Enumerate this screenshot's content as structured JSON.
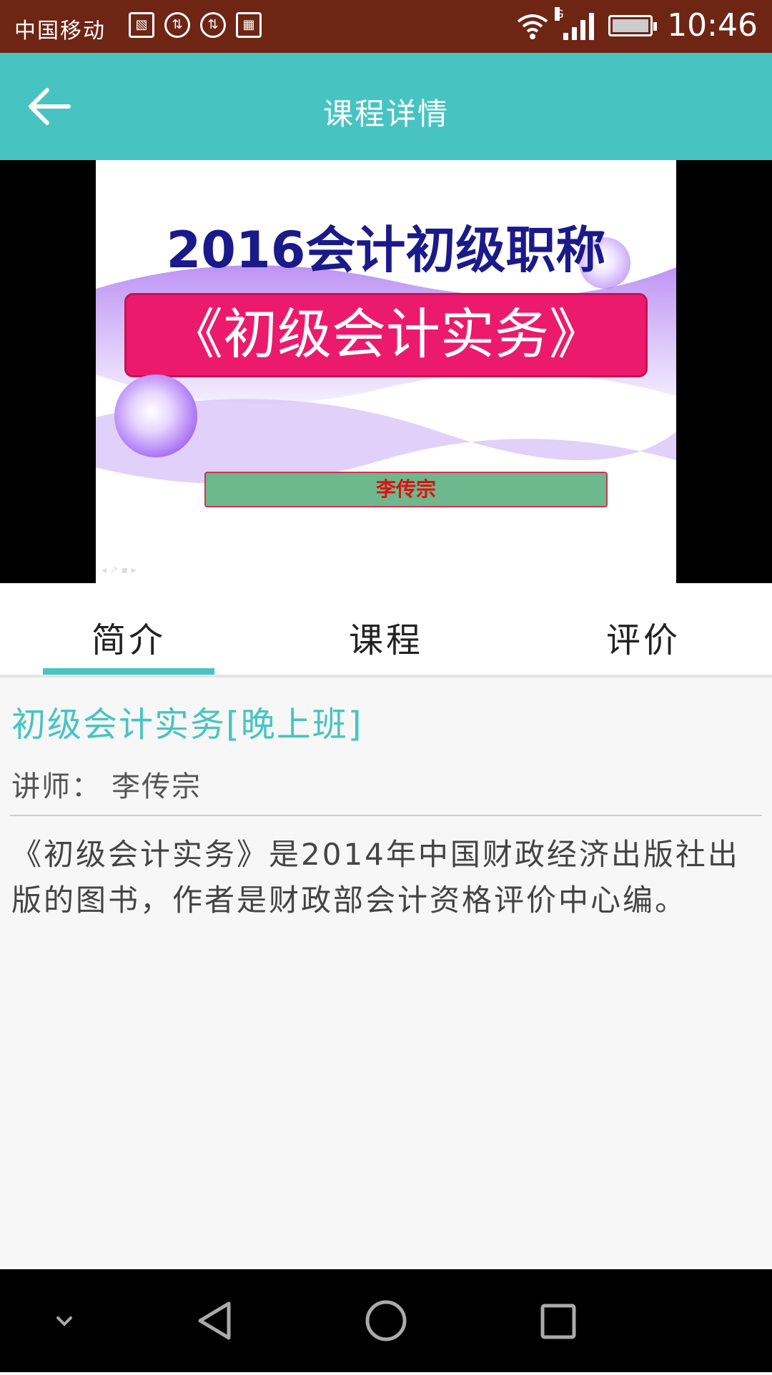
{
  "status_bar": {
    "carrier": "中国移动",
    "network_type": "G",
    "time": "10:46"
  },
  "toolbar": {
    "title": "课程详情",
    "back_icon": "arrow-left-icon"
  },
  "video": {
    "poster_year_title": "2016会计初级职称",
    "poster_book_title": "《初级会计实务》",
    "poster_teacher": "李传宗"
  },
  "tabs": [
    {
      "label": "简介",
      "active": true
    },
    {
      "label": "课程",
      "active": false
    },
    {
      "label": "评价",
      "active": false
    }
  ],
  "intro": {
    "course_title": "初级会计实务[晚上班]",
    "teacher_label": "讲师：",
    "teacher_name": "李传宗",
    "description": "《初级会计实务》是2014年中国财政经济出版社出版的图书，作者是财政部会计资格评价中心编。"
  },
  "colors": {
    "status_bar": "#6e2514",
    "accent": "#47c4c2",
    "nav_bar": "#000000"
  },
  "nav_bar": {
    "icons": [
      "chevron-down-icon",
      "back-triangle-icon",
      "home-circle-icon",
      "recents-square-icon"
    ]
  }
}
